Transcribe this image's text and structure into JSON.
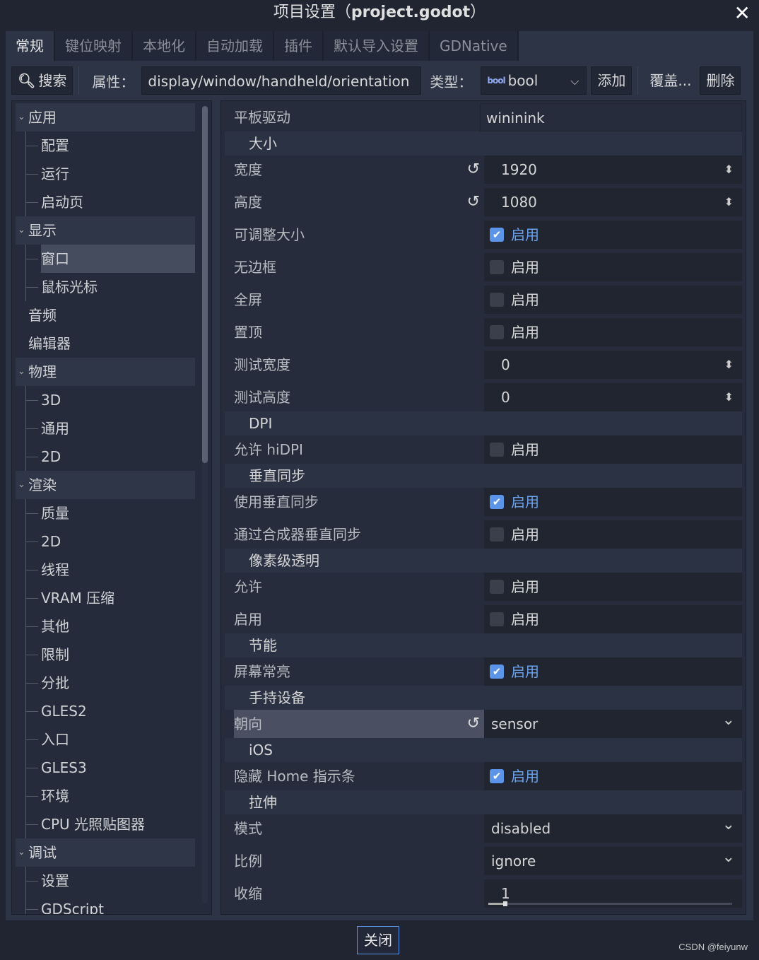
{
  "window": {
    "title_prefix": "项目设置（",
    "title_file": "project.godot",
    "title_suffix": "）"
  },
  "tabs": [
    "常规",
    "键位映射",
    "本地化",
    "自动加载",
    "插件",
    "默认导入设置",
    "GDNative"
  ],
  "toolbar": {
    "search": "搜索",
    "property_label": "属性：",
    "property_value": "display/window/handheld/orientation",
    "type_label": "类型：",
    "type_icon": "bool",
    "type_value": "bool",
    "add": "添加",
    "override": "覆盖...",
    "delete": "删除"
  },
  "tree": [
    {
      "label": "应用",
      "kind": "cat"
    },
    {
      "label": "配置",
      "kind": "child"
    },
    {
      "label": "运行",
      "kind": "child"
    },
    {
      "label": "启动页",
      "kind": "child"
    },
    {
      "label": "显示",
      "kind": "cat"
    },
    {
      "label": "窗口",
      "kind": "sel"
    },
    {
      "label": "鼠标光标",
      "kind": "child"
    },
    {
      "label": "音频",
      "kind": "top"
    },
    {
      "label": "编辑器",
      "kind": "top"
    },
    {
      "label": "物理",
      "kind": "cat"
    },
    {
      "label": "3D",
      "kind": "child"
    },
    {
      "label": "通用",
      "kind": "child"
    },
    {
      "label": "2D",
      "kind": "child"
    },
    {
      "label": "渲染",
      "kind": "cat"
    },
    {
      "label": "质量",
      "kind": "child"
    },
    {
      "label": "2D",
      "kind": "child"
    },
    {
      "label": "线程",
      "kind": "child"
    },
    {
      "label": "VRAM 压缩",
      "kind": "child"
    },
    {
      "label": "其他",
      "kind": "child"
    },
    {
      "label": "限制",
      "kind": "child"
    },
    {
      "label": "分批",
      "kind": "child"
    },
    {
      "label": "GLES2",
      "kind": "child"
    },
    {
      "label": "入口",
      "kind": "child"
    },
    {
      "label": "GLES3",
      "kind": "child"
    },
    {
      "label": "环境",
      "kind": "child"
    },
    {
      "label": "CPU 光照贴图器",
      "kind": "child"
    },
    {
      "label": "调试",
      "kind": "cat"
    },
    {
      "label": "设置",
      "kind": "child"
    },
    {
      "label": "GDScript",
      "kind": "child"
    }
  ],
  "props": [
    {
      "t": "prop",
      "label": "平板驱动",
      "value": "wininink",
      "kind": "text"
    },
    {
      "t": "sect",
      "label": "大小"
    },
    {
      "t": "prop",
      "label": "宽度",
      "value": "1920",
      "kind": "spin",
      "reset": true
    },
    {
      "t": "prop",
      "label": "高度",
      "value": "1080",
      "kind": "spin",
      "reset": true
    },
    {
      "t": "prop",
      "label": "可调整大小",
      "value": "启用",
      "kind": "check",
      "checked": true
    },
    {
      "t": "prop",
      "label": "无边框",
      "value": "启用",
      "kind": "check",
      "checked": false
    },
    {
      "t": "prop",
      "label": "全屏",
      "value": "启用",
      "kind": "check",
      "checked": false
    },
    {
      "t": "prop",
      "label": "置顶",
      "value": "启用",
      "kind": "check",
      "checked": false
    },
    {
      "t": "prop",
      "label": "测试宽度",
      "value": "0",
      "kind": "spin"
    },
    {
      "t": "prop",
      "label": "测试高度",
      "value": "0",
      "kind": "spin"
    },
    {
      "t": "sect",
      "label": "DPI"
    },
    {
      "t": "prop",
      "label": "允许 hiDPI",
      "value": "启用",
      "kind": "check",
      "checked": false
    },
    {
      "t": "sect",
      "label": "垂直同步"
    },
    {
      "t": "prop",
      "label": "使用垂直同步",
      "value": "启用",
      "kind": "check",
      "checked": true
    },
    {
      "t": "prop",
      "label": "通过合成器垂直同步",
      "value": "启用",
      "kind": "check",
      "checked": false
    },
    {
      "t": "sect",
      "label": "像素级透明"
    },
    {
      "t": "prop",
      "label": "允许",
      "value": "启用",
      "kind": "check",
      "checked": false
    },
    {
      "t": "prop",
      "label": "启用",
      "value": "启用",
      "kind": "check",
      "checked": false
    },
    {
      "t": "sect",
      "label": "节能"
    },
    {
      "t": "prop",
      "label": "屏幕常亮",
      "value": "启用",
      "kind": "check",
      "checked": true
    },
    {
      "t": "sect",
      "label": "手持设备"
    },
    {
      "t": "prop",
      "label": "朝向",
      "value": "sensor",
      "kind": "dropdown",
      "reset": true,
      "selected": true
    },
    {
      "t": "sect",
      "label": "iOS"
    },
    {
      "t": "prop",
      "label": "隐藏 Home 指示条",
      "value": "启用",
      "kind": "check",
      "checked": true
    },
    {
      "t": "sect",
      "label": "拉伸"
    },
    {
      "t": "prop",
      "label": "模式",
      "value": "disabled",
      "kind": "dropdown"
    },
    {
      "t": "prop",
      "label": "比例",
      "value": "ignore",
      "kind": "dropdown"
    },
    {
      "t": "prop",
      "label": "收缩",
      "value": "1",
      "kind": "slider",
      "slider_fraction": 0.06
    }
  ],
  "footer": {
    "close": "关闭",
    "watermark": "CSDN @feiyunw"
  },
  "colors": {
    "accent": "#5c95e8",
    "bg": "#202531",
    "panel": "#2c3446"
  }
}
